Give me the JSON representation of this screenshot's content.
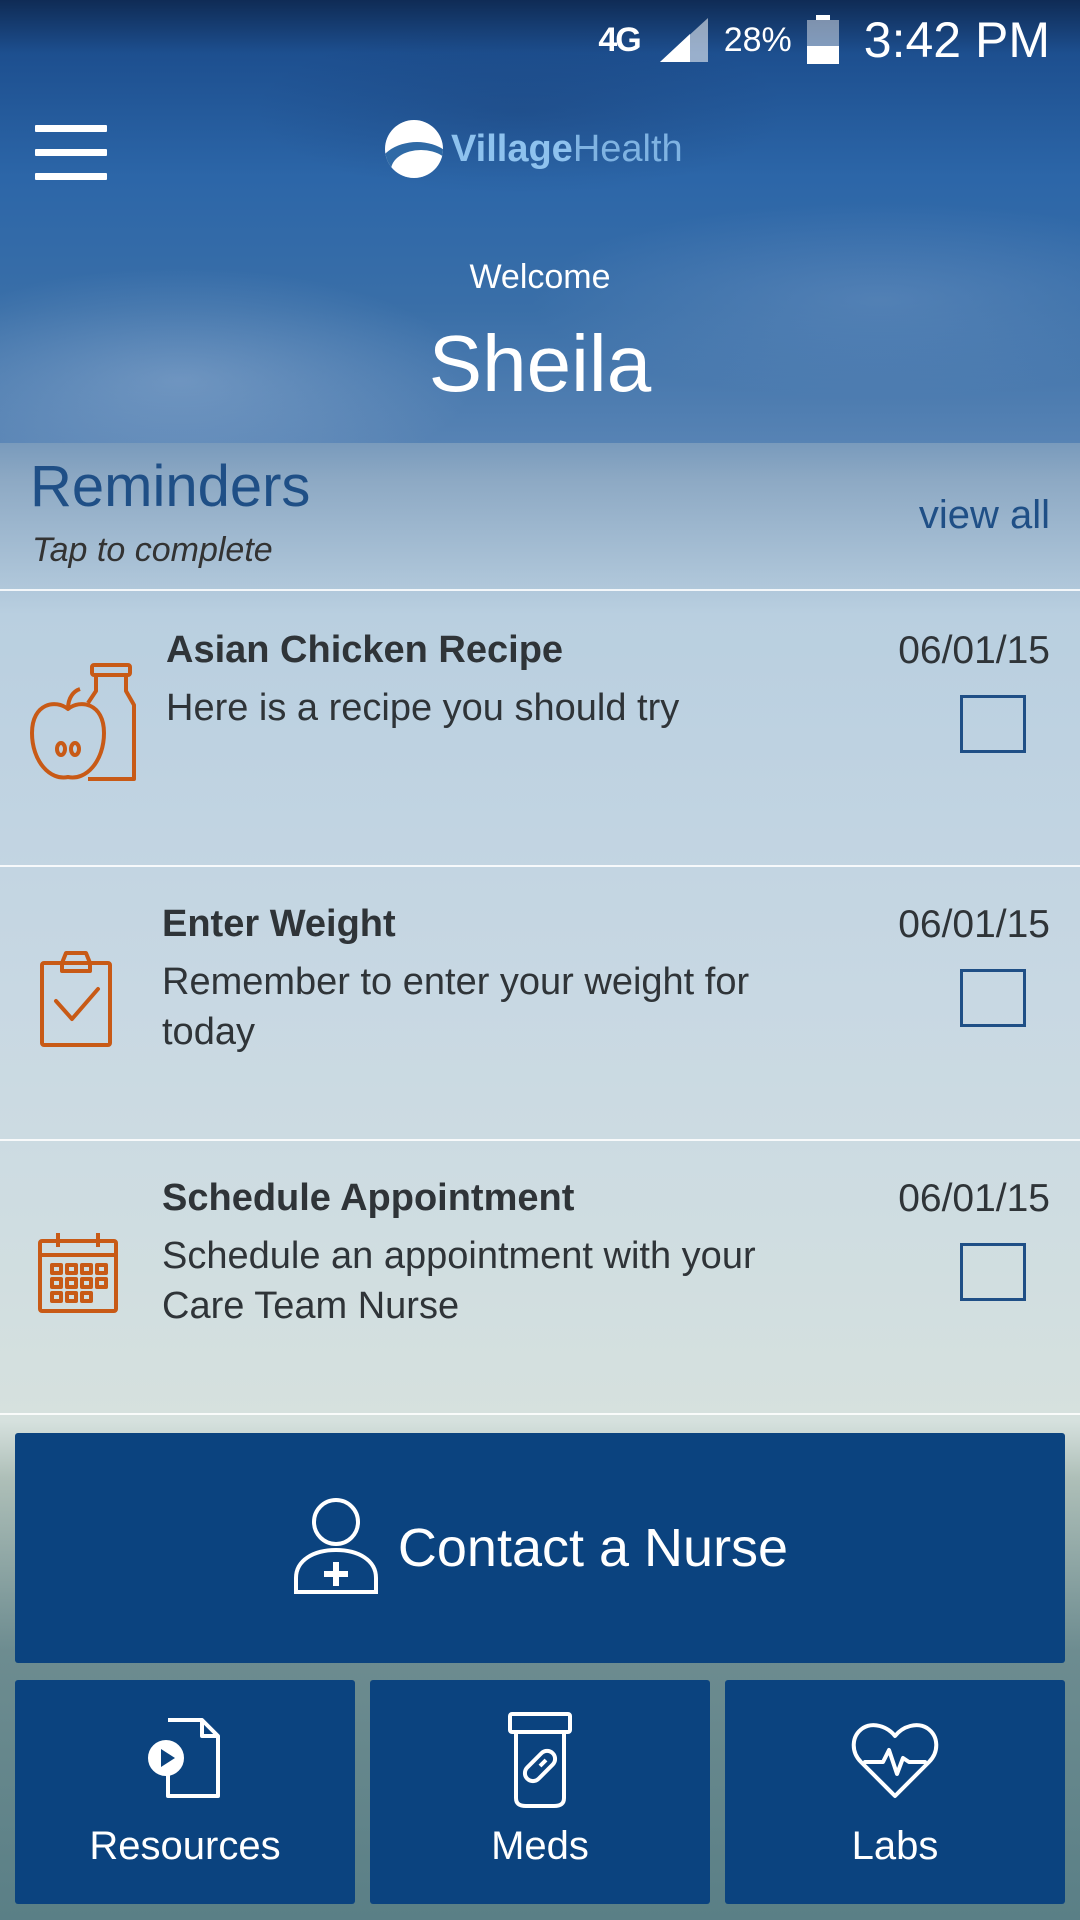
{
  "status_bar": {
    "network": "4G",
    "battery_percent": "28%",
    "time": "3:42 PM"
  },
  "app_bar": {
    "logo_text_bold": "Village",
    "logo_text_regular": "Health"
  },
  "greeting": {
    "welcome": "Welcome",
    "name": "Sheila"
  },
  "reminders": {
    "title": "Reminders",
    "subtitle": "Tap to complete",
    "view_all": "view all",
    "items": [
      {
        "icon": "apple-bottle-icon",
        "title": "Asian Chicken Recipe",
        "description": "Here is a recipe you should try",
        "date": "06/01/15",
        "completed": false
      },
      {
        "icon": "clipboard-check-icon",
        "title": "Enter Weight",
        "description": "Remember to enter your weight for today",
        "date": "06/01/15",
        "completed": false
      },
      {
        "icon": "calendar-icon",
        "title": "Schedule Appointment",
        "description": "Schedule an appointment with your Care Team Nurse",
        "date": "06/01/15",
        "completed": false
      }
    ]
  },
  "actions": {
    "contact": {
      "label": "Contact a Nurse",
      "icon": "nurse-icon"
    },
    "tiles": [
      {
        "label": "Resources",
        "icon": "play-document-icon"
      },
      {
        "label": "Meds",
        "icon": "pill-bottle-icon"
      },
      {
        "label": "Labs",
        "icon": "heart-pulse-icon"
      }
    ]
  },
  "colors": {
    "primary": "#0b437f",
    "accent_orange": "#c85a16",
    "heading_blue": "#1f4f86"
  }
}
